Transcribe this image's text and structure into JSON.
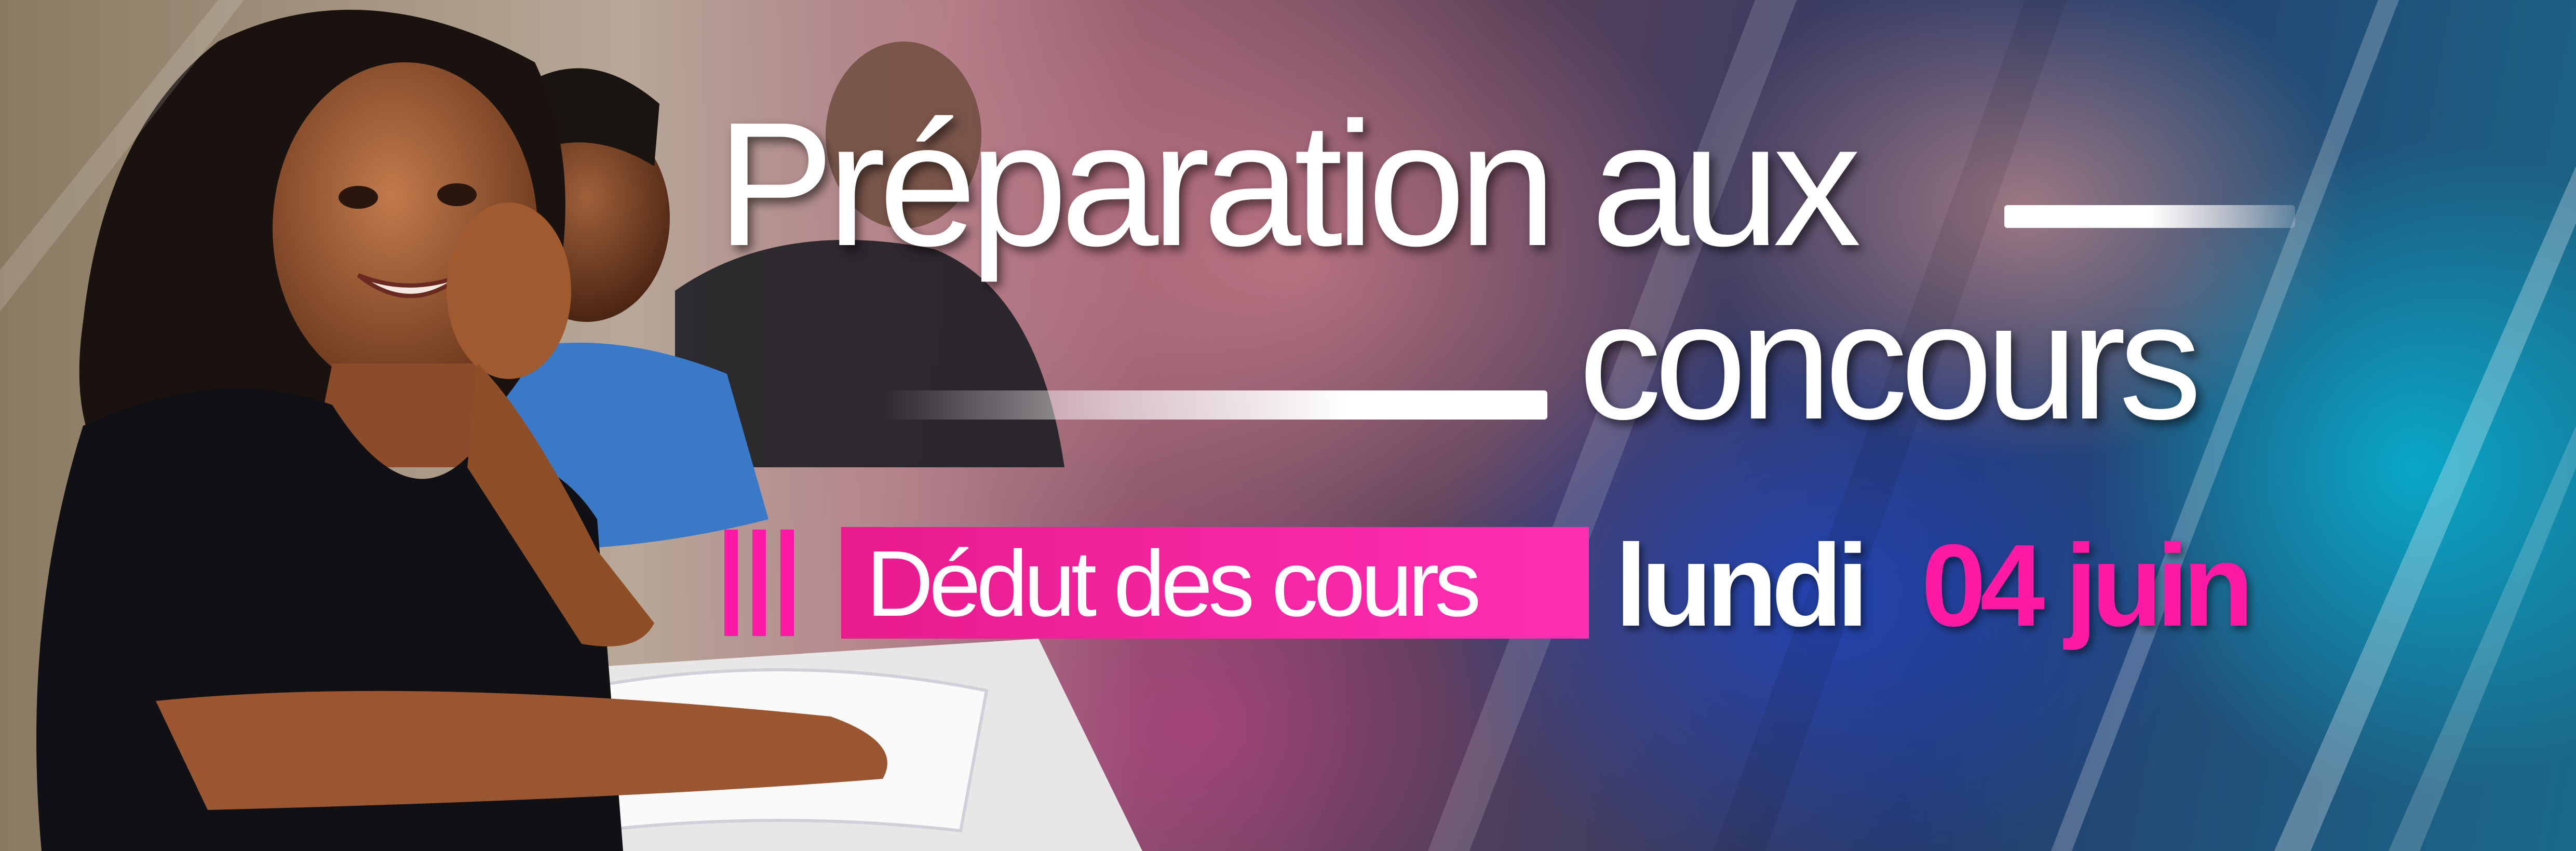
{
  "banner": {
    "title_line1": "Préparation aux",
    "title_line2": "concours",
    "start_label": "Dédut des cours",
    "start_day": "lundi",
    "start_date": "04 juin"
  },
  "colors": {
    "accent_pink": "#ff1aa6",
    "text_white": "#ffffff"
  },
  "image": {
    "subject": "student-photo"
  }
}
